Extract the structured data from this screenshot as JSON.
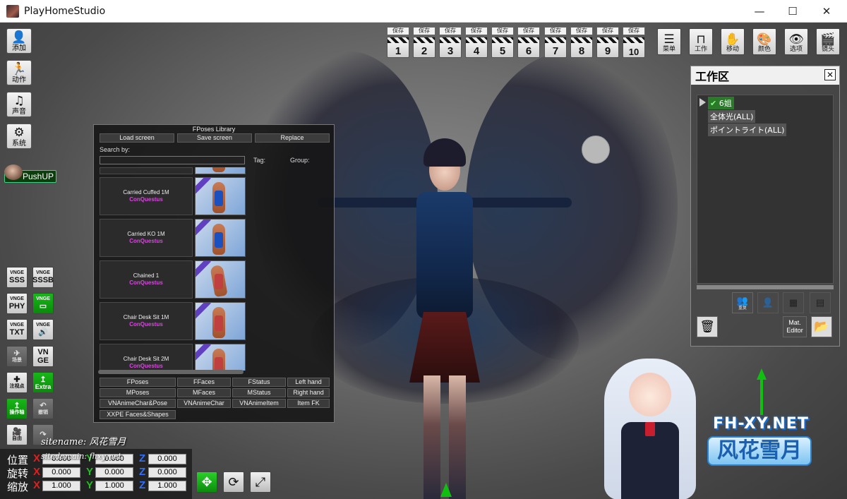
{
  "window": {
    "title": "PlayHomeStudio",
    "minimize": "—",
    "maximize": "☐",
    "close": "✕"
  },
  "left_toolbar": [
    {
      "label": "添加",
      "icon": "add-person-icon",
      "glyph": "👤"
    },
    {
      "label": "动作",
      "icon": "running-person-icon",
      "glyph": "🏃"
    },
    {
      "label": "声音",
      "icon": "music-note-icon",
      "glyph": "♫"
    },
    {
      "label": "系统",
      "icon": "gears-icon",
      "glyph": "⚙"
    }
  ],
  "pushup": {
    "label": "PushUP"
  },
  "vnge_buttons": [
    {
      "top": "VNGE",
      "bottom": "SSS",
      "green": false
    },
    {
      "top": "VNGE",
      "bottom": "SSSB",
      "green": false
    },
    {
      "top": "VNGE",
      "bottom": "PHY",
      "green": false
    },
    {
      "top": "VNGE",
      "bottom": "▭",
      "green": true
    },
    {
      "top": "VNGE",
      "bottom": "TXT",
      "green": false
    },
    {
      "top": "VNGE",
      "bottom": "🔊",
      "green": false
    }
  ],
  "tool_buttons_lower": [
    {
      "label": "场景",
      "glyph": "✈"
    },
    {
      "label": "VN GE",
      "glyph": ""
    },
    {
      "label": "注视点",
      "glyph": "✚"
    },
    {
      "label": "Extra",
      "glyph": "↥"
    },
    {
      "label": "操作轴",
      "glyph": "↥"
    },
    {
      "label": "撤销",
      "glyph": "↶"
    },
    {
      "label": "自由",
      "glyph": "🎥"
    },
    {
      "label": "",
      "glyph": "↷"
    }
  ],
  "save_slots": [
    {
      "tag": "保存",
      "num": "1"
    },
    {
      "tag": "保存",
      "num": "2"
    },
    {
      "tag": "保存",
      "num": "3"
    },
    {
      "tag": "保存",
      "num": "4"
    },
    {
      "tag": "保存",
      "num": "5"
    },
    {
      "tag": "保存",
      "num": "6"
    },
    {
      "tag": "保存",
      "num": "7"
    },
    {
      "tag": "保存",
      "num": "8"
    },
    {
      "tag": "保存",
      "num": "9"
    },
    {
      "tag": "保存",
      "num": "10"
    }
  ],
  "top_menu": [
    {
      "label": "菜单",
      "glyph": "☰"
    },
    {
      "label": "工作",
      "glyph": "⊓"
    },
    {
      "label": "移动",
      "glyph": "✋"
    },
    {
      "label": "颜色",
      "glyph": "🎨"
    },
    {
      "label": "选项",
      "glyph": "👁"
    },
    {
      "label": "镜头",
      "glyph": "🎬"
    }
  ],
  "workspace": {
    "title": "工作区",
    "close": "✕",
    "items": [
      {
        "label": "6姐",
        "checked": true
      },
      {
        "label": "全体光(ALL)"
      },
      {
        "label": "ポイントライト(ALL)"
      }
    ],
    "icons_row1": [
      {
        "label": "重复",
        "glyph": "👥"
      },
      {
        "label": "",
        "glyph": "👤"
      },
      {
        "label": "",
        "glyph": "▦"
      },
      {
        "label": "",
        "glyph": "▤"
      }
    ],
    "mat_editor": "Mat. Editor",
    "delete_icon": "🗑",
    "folder_icon": "📂"
  },
  "fposes": {
    "title": "FPoses Library",
    "load_screen": "Load screen",
    "save_screen": "Save screen",
    "replace": "Replace",
    "search_by": "Search by:",
    "tag": "Tag:",
    "group": "Group:",
    "poses": [
      {
        "name": "Carried Cuffed 1M",
        "author": "ConQuestus"
      },
      {
        "name": "Carried KO 1M",
        "author": "ConQuestus"
      },
      {
        "name": "Chained 1",
        "author": "ConQuestus"
      },
      {
        "name": "Chair Desk Sit 1M",
        "author": "ConQuestus"
      },
      {
        "name": "Chair Desk Sit 2M",
        "author": "ConQuestus"
      }
    ],
    "tabs": [
      [
        "FPoses",
        "FFaces",
        "FStatus",
        "Left hand"
      ],
      [
        "MPoses",
        "MFaces",
        "MStatus",
        "Right hand"
      ],
      [
        "VNAnimeChar&Pose",
        "VNAnimeChar",
        "VNAnimeItem",
        "Item FK"
      ],
      [
        "XXPE Faces&Shapes"
      ]
    ]
  },
  "transform": {
    "rows": [
      {
        "label": "位置",
        "x": "0.000",
        "y": "0.000",
        "z": "0.000"
      },
      {
        "label": "旋转",
        "x": "0.000",
        "y": "0.000",
        "z": "0.000"
      },
      {
        "label": "缩放",
        "x": "1.000",
        "y": "1.000",
        "z": "1.000"
      }
    ],
    "axis_labels": {
      "x": "X",
      "y": "Y",
      "z": "Z"
    }
  },
  "watermark": {
    "sitename": "sitename: 风花雪月",
    "sitedomain": "sitedomain: fhxy-net",
    "brand": "FH-XY.NET",
    "brand_cn": "风花雪月"
  }
}
